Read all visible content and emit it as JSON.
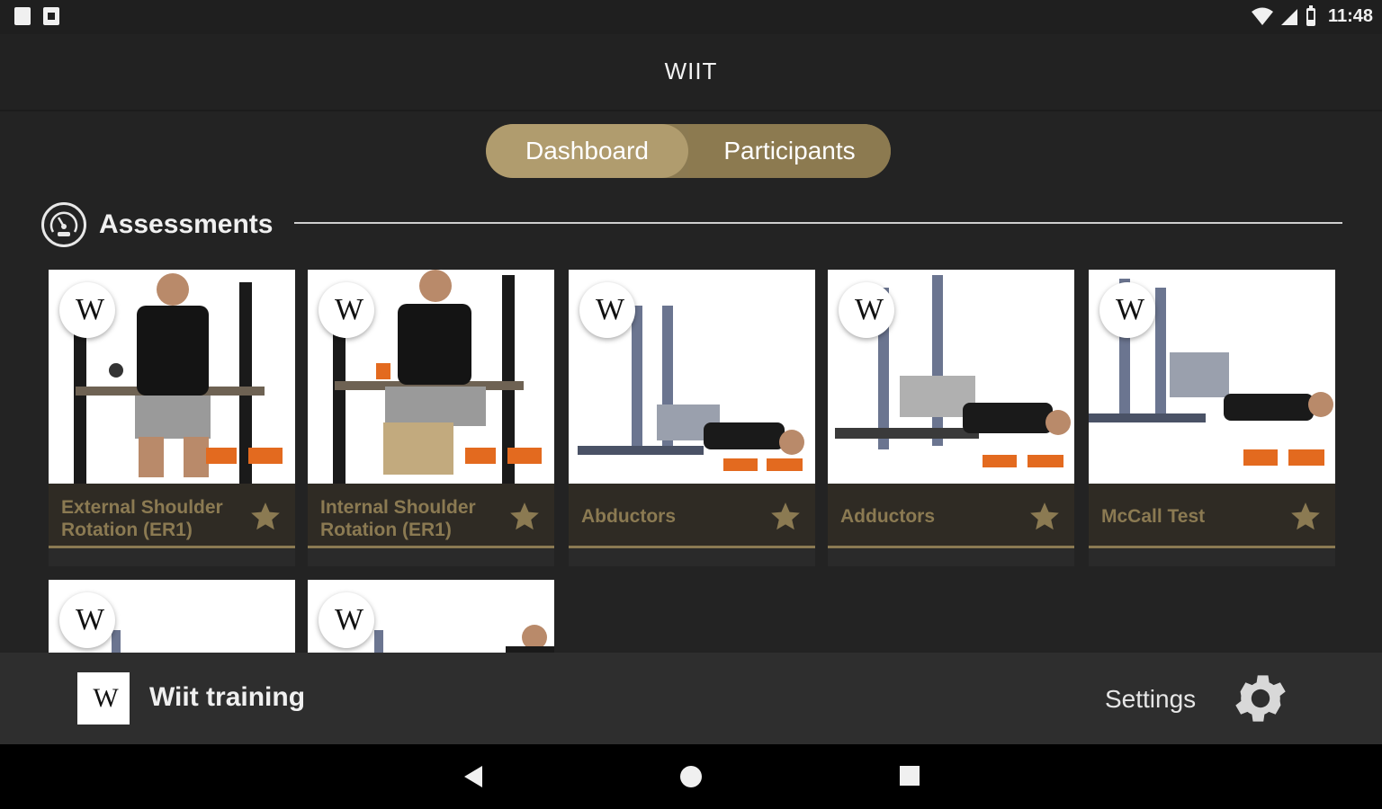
{
  "status_bar": {
    "time": "11:48"
  },
  "app": {
    "title": "WIIT"
  },
  "tabs": [
    {
      "label": "Dashboard",
      "active": true
    },
    {
      "label": "Participants",
      "active": false
    }
  ],
  "section": {
    "icon": "gauge-icon",
    "title": "Assessments"
  },
  "cards": [
    {
      "title": "External Shoulder Rotation (ER1)",
      "logo": "W"
    },
    {
      "title": "Internal Shoulder Rotation (ER1)",
      "logo": "W"
    },
    {
      "title": "Abductors",
      "logo": "W"
    },
    {
      "title": "Adductors",
      "logo": "W"
    },
    {
      "title": "McCall Test",
      "logo": "W"
    }
  ],
  "cards_row2": [
    {
      "logo": "W"
    },
    {
      "logo": "W"
    }
  ],
  "bottom_bar": {
    "logo": "W",
    "name": "Wiit training",
    "settings_label": "Settings"
  },
  "colors": {
    "accent": "#8b7a52",
    "active_tab": "#b09c6e",
    "background": "#232323"
  }
}
